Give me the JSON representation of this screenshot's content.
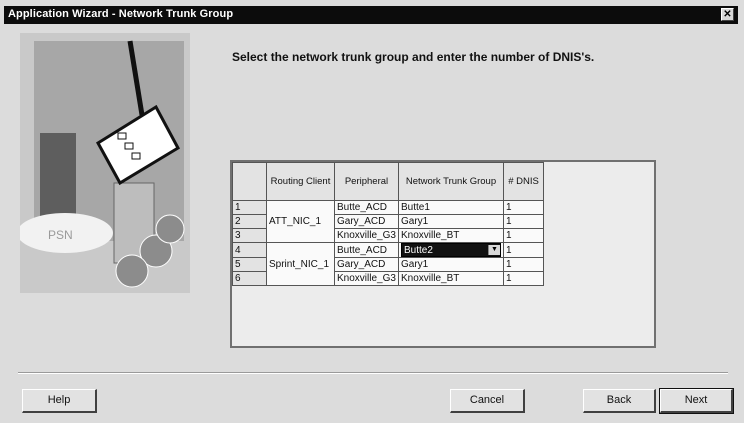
{
  "window": {
    "title": "Application Wizard - Network Trunk Group",
    "close_glyph": "✕"
  },
  "illustration": {
    "caption": "PSN"
  },
  "heading": "Select the network trunk group and enter the number of DNIS's.",
  "grid": {
    "columns": [
      "Routing Client",
      "Peripheral",
      "Network Trunk Group",
      "# DNIS"
    ],
    "rows": [
      {
        "num": "1",
        "client": "",
        "peripheral": "Butte_ACD",
        "ntg": "Butte1",
        "dnis": "1"
      },
      {
        "num": "2",
        "client": "ATT_NIC_1",
        "peripheral": "Gary_ACD",
        "ntg": "Gary1",
        "dnis": "1"
      },
      {
        "num": "3",
        "client": "",
        "peripheral": "Knoxville_G3",
        "ntg": "Knoxville_BT",
        "dnis": "1"
      },
      {
        "num": "4",
        "client": "",
        "peripheral": "Butte_ACD",
        "ntg": "Butte2",
        "dnis": "1"
      },
      {
        "num": "5",
        "client": "Sprint_NIC_1",
        "peripheral": "Gary_ACD",
        "ntg": "Gary1",
        "dnis": "1"
      },
      {
        "num": "6",
        "client": "",
        "peripheral": "Knoxville_G3",
        "ntg": "Knoxville_BT",
        "dnis": "1"
      }
    ]
  },
  "buttons": {
    "help": "Help",
    "cancel": "Cancel",
    "back": "Back",
    "next": "Next"
  }
}
